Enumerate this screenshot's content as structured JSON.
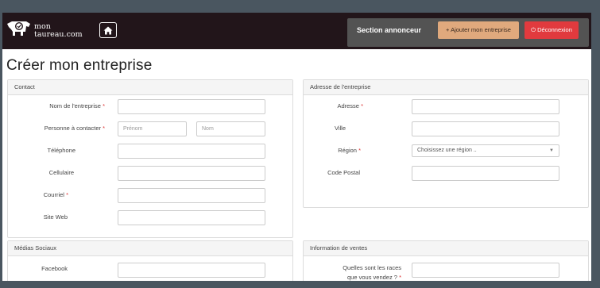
{
  "header": {
    "logo_line1": "mon",
    "logo_line2": "taureau.com",
    "section_label": "Section annonceur",
    "add_button": "+ Ajouter mon entreprise",
    "logout_button": "⏻ Déconnexion"
  },
  "page": {
    "title": "Créer mon entreprise"
  },
  "contact": {
    "heading": "Contact",
    "company_label": "Nom de l'entreprise",
    "person_label": "Personne à contacter",
    "first_name_placeholder": "Prénom",
    "last_name_placeholder": "Nom",
    "phone_label": "Téléphone",
    "cell_label": "Cellulaire",
    "email_label": "Courriel",
    "website_label": "Site Web",
    "required_mark": "*"
  },
  "address": {
    "heading": "Adresse de l'entreprise",
    "address_label": "Adresse",
    "city_label": "Ville",
    "region_label": "Région",
    "region_placeholder": "Choisissez une région ..",
    "postal_label": "Code Postal"
  },
  "social": {
    "heading": "Médias Sociaux",
    "facebook_label": "Facebook"
  },
  "sales": {
    "heading": "Information de ventes",
    "breeds_label_line1": "Quelles sont les races",
    "breeds_label_line2": "que vous vendez ?"
  },
  "colors": {
    "topbar": "#22151a",
    "add_button": "#e0a97d",
    "logout_button": "#e13a3e",
    "required": "#d33333"
  }
}
